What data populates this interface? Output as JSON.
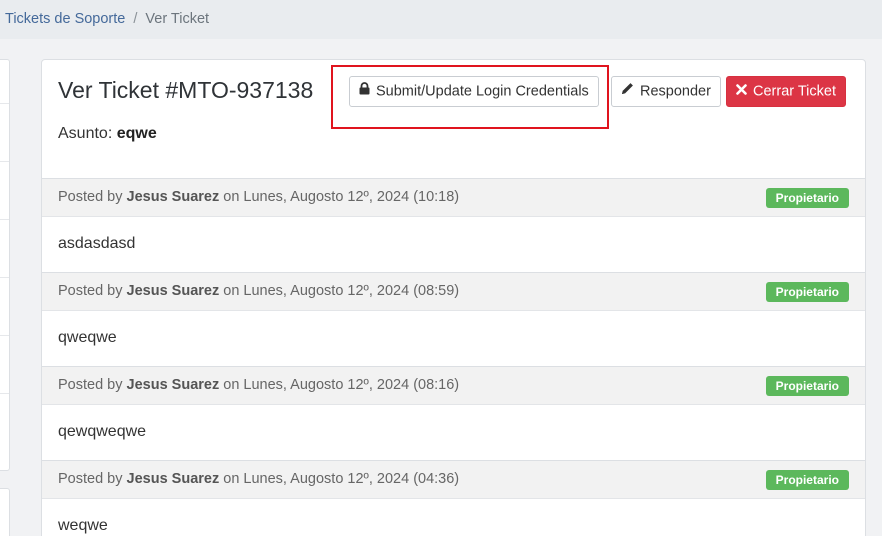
{
  "breadcrumb": {
    "link": "Tickets de Soporte",
    "separator": "/",
    "current": "Ver Ticket"
  },
  "ticket": {
    "title": "Ver Ticket #MTO-937138",
    "subject_label": "Asunto:",
    "subject_value": "eqwe"
  },
  "buttons": {
    "credentials": "Submit/Update Login Credentials",
    "reply": "Responder",
    "close": "Cerrar Ticket"
  },
  "colors": {
    "danger": "#dc3545",
    "success": "#5cb85c",
    "link": "#44699a",
    "highlight": "#e0141e"
  },
  "replies": [
    {
      "posted_by": "Posted by",
      "author": "Jesus Suarez",
      "on": "on Lunes, Augosto 12º, 2024 (10:18)",
      "badge": "Propietario",
      "message": "asdasdasd"
    },
    {
      "posted_by": "Posted by",
      "author": "Jesus Suarez",
      "on": "on Lunes, Augosto 12º, 2024 (08:59)",
      "badge": "Propietario",
      "message": "qweqwe"
    },
    {
      "posted_by": "Posted by",
      "author": "Jesus Suarez",
      "on": "on Lunes, Augosto 12º, 2024 (08:16)",
      "badge": "Propietario",
      "message": "qewqweqwe"
    },
    {
      "posted_by": "Posted by",
      "author": "Jesus Suarez",
      "on": "on Lunes, Augosto 12º, 2024 (04:36)",
      "badge": "Propietario",
      "message": "weqwe"
    }
  ]
}
